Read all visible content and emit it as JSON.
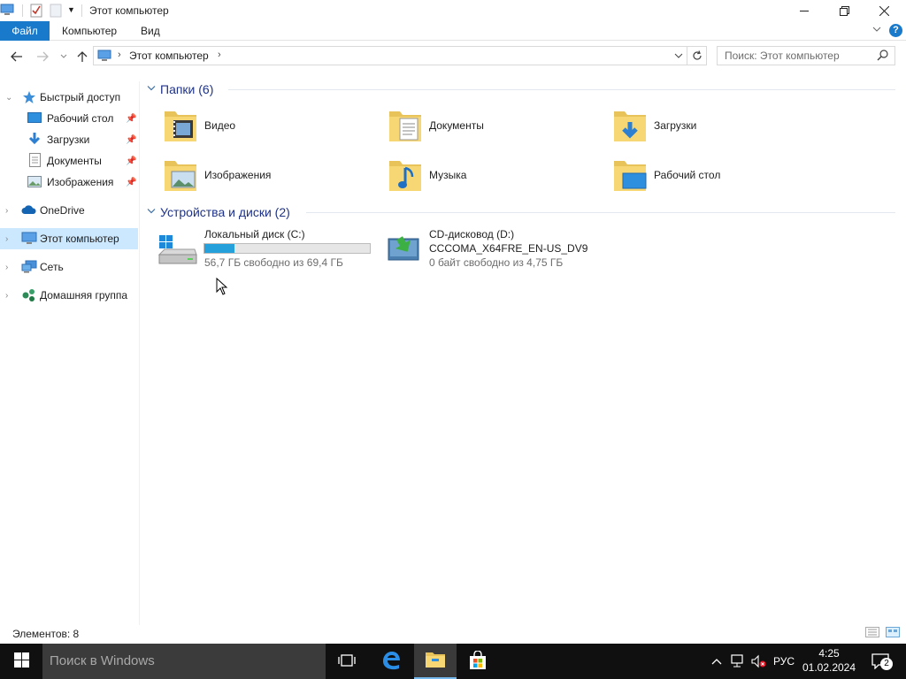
{
  "window": {
    "title": "Этот компьютер"
  },
  "ribbon": {
    "tabs": [
      "Файл",
      "Компьютер",
      "Вид"
    ]
  },
  "address": {
    "path": "Этот компьютер",
    "search_placeholder": "Поиск: Этот компьютер"
  },
  "sidebar": {
    "quick_access": "Быстрый доступ",
    "pinned": [
      {
        "label": "Рабочий стол",
        "icon": "desktop-icon"
      },
      {
        "label": "Загрузки",
        "icon": "downloads-icon"
      },
      {
        "label": "Документы",
        "icon": "documents-icon"
      },
      {
        "label": "Изображения",
        "icon": "pictures-icon"
      }
    ],
    "onedrive": "OneDrive",
    "this_pc": "Этот компьютер",
    "network": "Сеть",
    "homegroup": "Домашняя группа"
  },
  "main": {
    "folders_header": "Папки (6)",
    "folders": [
      {
        "label": "Видео",
        "icon": "videos-folder-icon"
      },
      {
        "label": "Документы",
        "icon": "documents-folder-icon"
      },
      {
        "label": "Загрузки",
        "icon": "downloads-folder-icon"
      },
      {
        "label": "Изображения",
        "icon": "pictures-folder-icon"
      },
      {
        "label": "Музыка",
        "icon": "music-folder-icon"
      },
      {
        "label": "Рабочий стол",
        "icon": "desktop-folder-icon"
      }
    ],
    "drives_header": "Устройства и диски (2)",
    "drives": [
      {
        "name": "Локальный диск (C:)",
        "free": "56,7 ГБ свободно из 69,4 ГБ",
        "used_fraction": 0.18,
        "icon": "local-disk-icon"
      },
      {
        "name": "CD-дисковод (D:)",
        "name2": "CCCOMA_X64FRE_EN-US_DV9",
        "free": "0 байт свободно из 4,75 ГБ",
        "icon": "cd-drive-icon"
      }
    ]
  },
  "status": {
    "count": "Элементов: 8"
  },
  "taskbar": {
    "search_text": "Поиск в Windows",
    "language": "РУС",
    "time": "4:25",
    "date": "01.02.2024",
    "notifications": "2"
  },
  "colors": {
    "accent": "#1979ca",
    "selection": "#cce8ff",
    "progress": "#26a0da",
    "taskbar": "#101010"
  }
}
